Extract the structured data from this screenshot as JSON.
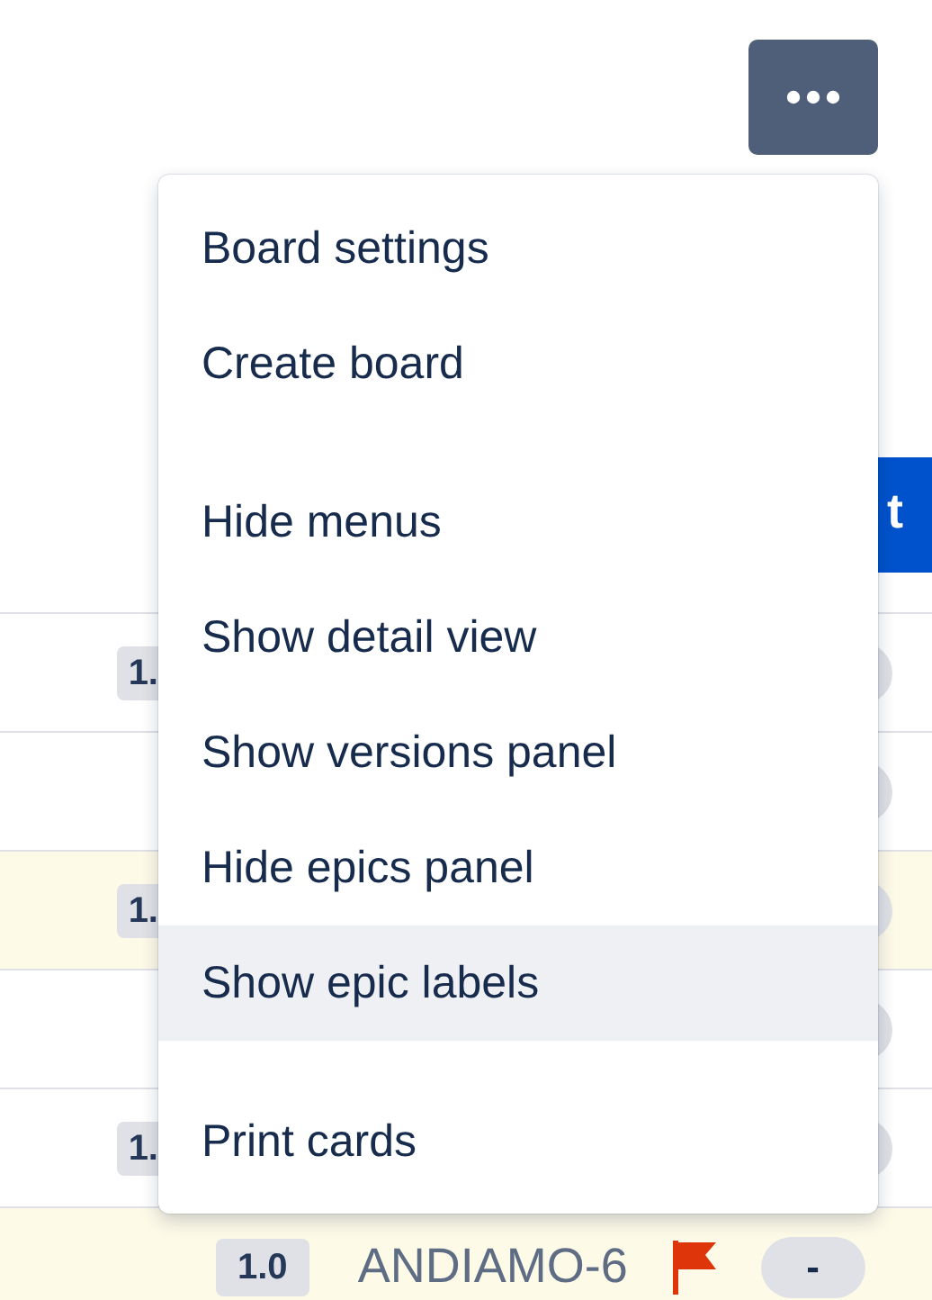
{
  "primary_button": {
    "label": "t"
  },
  "rows": [
    {
      "version": "1.",
      "highlighted": false
    },
    {
      "highlighted": false
    },
    {
      "version": "1.",
      "highlighted": true
    },
    {
      "highlighted": false
    },
    {
      "version": "1.",
      "highlighted": false
    },
    {
      "version": "1.0",
      "key": "ANDIAMO-6",
      "flagged": true,
      "estimate": "-",
      "highlighted": true
    }
  ],
  "menu": {
    "sections": [
      {
        "items": [
          {
            "label": "Board settings",
            "highlighted": false
          },
          {
            "label": "Create board",
            "highlighted": false
          }
        ]
      },
      {
        "items": [
          {
            "label": "Hide menus",
            "highlighted": false
          },
          {
            "label": "Show detail view",
            "highlighted": false
          },
          {
            "label": "Show versions panel",
            "highlighted": false
          },
          {
            "label": "Hide epics panel",
            "highlighted": false
          },
          {
            "label": "Show epic labels",
            "highlighted": true
          }
        ]
      },
      {
        "items": [
          {
            "label": "Print cards",
            "highlighted": false
          }
        ]
      }
    ]
  }
}
